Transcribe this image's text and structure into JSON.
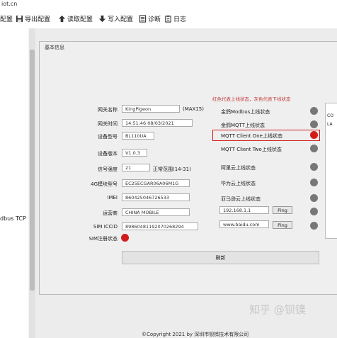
{
  "window": {
    "title": "iot.cn"
  },
  "toolbar": {
    "items": [
      {
        "label": "配置"
      },
      {
        "label": "导出配置"
      },
      {
        "label": "读取配置"
      },
      {
        "label": "写入配置"
      },
      {
        "label": "诊断"
      },
      {
        "label": "日志"
      }
    ]
  },
  "sidebar": {
    "item_label": "dbus TCP"
  },
  "panel": {
    "title": "基本信息",
    "notice": "红色代表上线状态，灰色代表下线状态",
    "fields": [
      {
        "label": "网关名称",
        "value": "KingPigeon",
        "suffix": "(MAX15)"
      },
      {
        "label": "网关时间",
        "value": "14:51:46 08/03/2021",
        "suffix": ""
      },
      {
        "label": "设备型号",
        "value": "BL110UA",
        "suffix": ""
      },
      {
        "label": "设备版本",
        "value": "V1.0.3",
        "suffix": ""
      },
      {
        "label": "信号强度",
        "value": "21",
        "suffix": "正常范围(14-31)"
      },
      {
        "label": "4G模块型号",
        "value": "EC25ECGAR06A06M1G",
        "suffix": ""
      },
      {
        "label": "IMEI",
        "value": "860425046726533",
        "suffix": ""
      },
      {
        "label": "运营商",
        "value": "CHINA MOBILE",
        "suffix": ""
      },
      {
        "label": "SIM ICCID",
        "value": "89860481192070268294",
        "suffix": ""
      }
    ],
    "sim_status_label": "SIM注册状态",
    "status_rows": [
      {
        "label": "金鸽Modbus上线状态"
      },
      {
        "label": "金鸽MQTT上线状态"
      },
      {
        "label": "MQTT Client One上线状态"
      },
      {
        "label": "MQTT Client Two上线状态"
      },
      {
        "label": "阿里云上线状态"
      },
      {
        "label": "华为云上线状态"
      },
      {
        "label": "亚马逊云上线状态"
      }
    ],
    "ping_rows": [
      {
        "value": "192.168.1.1",
        "button": "Ping"
      },
      {
        "value": "www.baidu.com",
        "button": "Ping"
      }
    ],
    "refresh_label": "刷新",
    "side_box_lines": [
      "CO",
      "LA"
    ]
  },
  "watermark": "知乎 @钡镤",
  "footer": "©Copyright 2021 by 深圳市钡铧技术有限公司",
  "colors": {
    "online": "#d21c1c",
    "offline": "#777777",
    "highlight_border": "#d21c1c"
  }
}
